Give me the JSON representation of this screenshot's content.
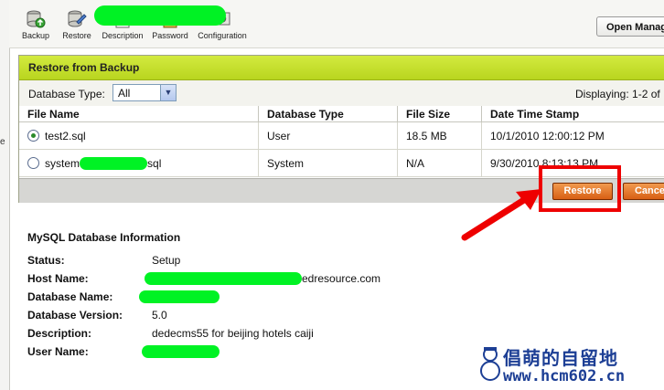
{
  "toolbar": {
    "items": [
      {
        "label": "Backup",
        "icon": "backup-icon"
      },
      {
        "label": "Restore",
        "icon": "restore-icon"
      },
      {
        "label": "Description",
        "icon": "description-icon"
      },
      {
        "label": "Password",
        "icon": "password-icon"
      },
      {
        "label": "Configuration",
        "icon": "configuration-icon"
      }
    ],
    "open_button": "Open Manage"
  },
  "panel": {
    "title": "Restore from Backup",
    "filter_label": "Database Type:",
    "filter_value": "All",
    "displaying": "Displaying: 1-2 of",
    "columns": [
      "File Name",
      "Database Type",
      "File Size",
      "Date Time Stamp"
    ],
    "rows": [
      {
        "file": "test2.sql",
        "file_suffix": "",
        "type": "User",
        "size": "18.5 MB",
        "date": "10/1/2010 12:00:12 PM",
        "selected": true
      },
      {
        "file": "system",
        "file_suffix": "sql",
        "type": "System",
        "size": "N/A",
        "date": "9/30/2010 8:13:13 PM",
        "selected": false
      }
    ],
    "restore_button": "Restore",
    "cancel_button": "Cancel"
  },
  "info": {
    "title": "MySQL Database Information",
    "rows": [
      {
        "label": "Status:",
        "value": "Setup"
      },
      {
        "label": "Host Name:",
        "value": "edresource.com"
      },
      {
        "label": "Database Name:",
        "value": ""
      },
      {
        "label": "Database Version:",
        "value": "5.0"
      },
      {
        "label": "Description:",
        "value": "dedecms55 for beijing hotels caiji"
      },
      {
        "label": "User Name:",
        "value": ""
      }
    ]
  },
  "watermark": {
    "line1": "倡萌的自留地",
    "line2": "www.hcm602.cn"
  },
  "colors": {
    "panel_title": "#c2dc2a",
    "button_orange": "#e0701f",
    "highlight_red": "#ee0000",
    "redaction_green": "#00f224",
    "watermark_blue": "#1d3f95"
  }
}
